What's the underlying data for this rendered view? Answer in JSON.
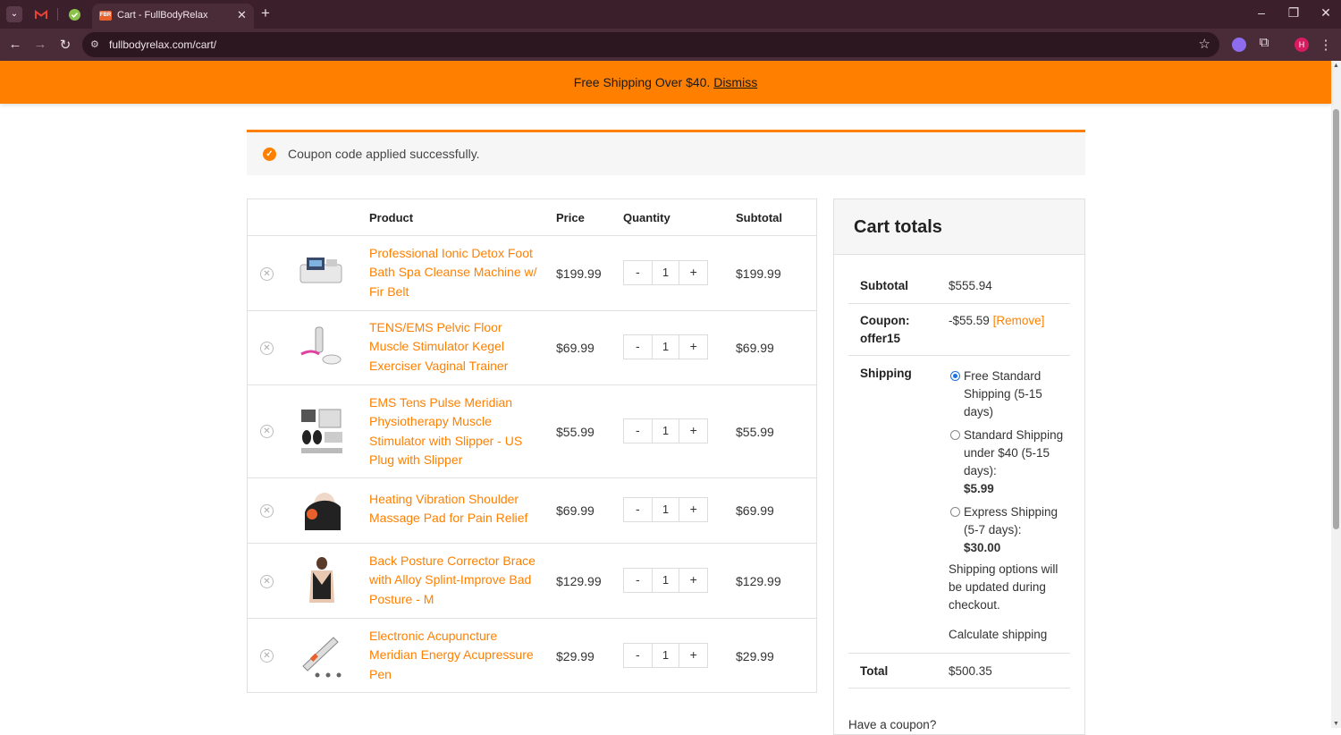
{
  "browser": {
    "tab_title": "Cart - FullBodyRelax",
    "tab_favicon_text": "FBR",
    "url": "fullbodyrelax.com/cart/",
    "profile_initial": "H"
  },
  "banner": {
    "text": "Free Shipping Over $40.",
    "dismiss_label": "Dismiss"
  },
  "notice": {
    "message": "Coupon code applied successfully."
  },
  "cart": {
    "headers": {
      "product": "Product",
      "price": "Price",
      "quantity": "Quantity",
      "subtotal": "Subtotal"
    },
    "items": [
      {
        "name": "Professional Ionic Detox Foot Bath Spa Cleanse Machine w/ Fir Belt",
        "price": "$199.99",
        "qty": "1",
        "subtotal": "$199.99"
      },
      {
        "name": "TENS/EMS Pelvic Floor Muscle Stimulator Kegel Exerciser Vaginal Trainer",
        "price": "$69.99",
        "qty": "1",
        "subtotal": "$69.99"
      },
      {
        "name": "EMS Tens Pulse Meridian Physiotherapy Muscle Stimulator with Slipper - US Plug with Slipper",
        "price": "$55.99",
        "qty": "1",
        "subtotal": "$55.99"
      },
      {
        "name": "Heating Vibration Shoulder Massage Pad for Pain Relief",
        "price": "$69.99",
        "qty": "1",
        "subtotal": "$69.99"
      },
      {
        "name": "Back Posture Corrector Brace with Alloy Splint-Improve Bad Posture - M",
        "price": "$129.99",
        "qty": "1",
        "subtotal": "$129.99"
      },
      {
        "name": "Electronic Acupuncture Meridian Energy Acupressure Pen",
        "price": "$29.99",
        "qty": "1",
        "subtotal": "$29.99"
      }
    ],
    "minus": "-",
    "plus": "+"
  },
  "totals": {
    "title": "Cart totals",
    "subtotal_label": "Subtotal",
    "subtotal_value": "$555.94",
    "coupon_label": "Coupon: offer15",
    "coupon_value": "-$55.59",
    "coupon_remove": "[Remove]",
    "shipping_label": "Shipping",
    "shipping_options": [
      {
        "label": "Free Standard Shipping (5-15 days)",
        "price": "",
        "selected": true
      },
      {
        "label": "Standard Shipping under $40 (5-15 days):",
        "price": "$5.99",
        "selected": false
      },
      {
        "label": "Express Shipping (5-7 days):",
        "price": "$30.00",
        "selected": false
      }
    ],
    "shipping_note": "Shipping options will be updated during checkout.",
    "calculate_shipping": "Calculate shipping",
    "total_label": "Total",
    "total_value": "$500.35",
    "have_coupon": "Have a coupon?"
  },
  "colors": {
    "accent": "#ff8000",
    "chrome_dark": "#3b1f2b",
    "chrome": "#4a2c38"
  }
}
